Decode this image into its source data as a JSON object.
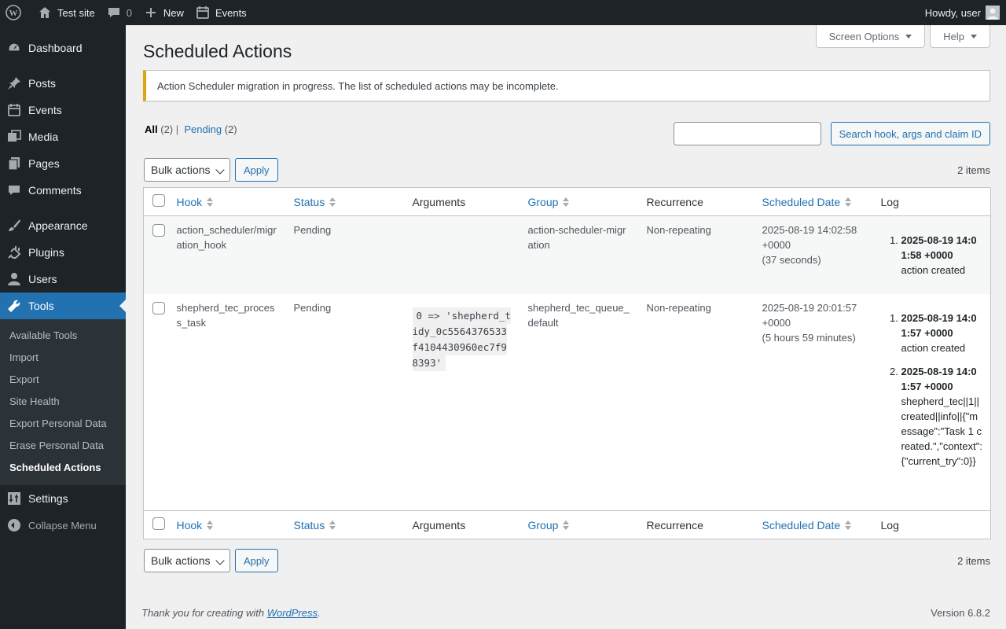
{
  "adminbar": {
    "site_name": "Test site",
    "comments_count": "0",
    "new_label": "New",
    "events_label": "Events",
    "howdy": "Howdy, user"
  },
  "sidebar": {
    "items": [
      {
        "label": "Dashboard",
        "icon": "dashboard-icon"
      },
      {
        "label": "Posts",
        "icon": "pin-icon"
      },
      {
        "label": "Events",
        "icon": "calendar-icon"
      },
      {
        "label": "Media",
        "icon": "media-icon"
      },
      {
        "label": "Pages",
        "icon": "pages-icon"
      },
      {
        "label": "Comments",
        "icon": "comment-icon"
      },
      {
        "label": "Appearance",
        "icon": "brush-icon"
      },
      {
        "label": "Plugins",
        "icon": "plugin-icon"
      },
      {
        "label": "Users",
        "icon": "user-icon"
      },
      {
        "label": "Tools",
        "icon": "wrench-icon"
      },
      {
        "label": "Settings",
        "icon": "settings-icon"
      }
    ],
    "tools_submenu": [
      "Available Tools",
      "Import",
      "Export",
      "Site Health",
      "Export Personal Data",
      "Erase Personal Data",
      "Scheduled Actions"
    ],
    "collapse_label": "Collapse Menu"
  },
  "screen_options_label": "Screen Options",
  "help_label": "Help",
  "page_title": "Scheduled Actions",
  "notice": "Action Scheduler migration in progress. The list of scheduled actions may be incomplete.",
  "views": {
    "all_label": "All",
    "all_count": "(2)",
    "separator": " |",
    "pending_label": "Pending",
    "pending_count": "(2)"
  },
  "search": {
    "button_label": "Search hook, args and claim ID",
    "value": ""
  },
  "bulk": {
    "selected": "Bulk actions",
    "apply_label": "Apply",
    "items_count": "2 items"
  },
  "columns": [
    "Hook",
    "Status",
    "Arguments",
    "Group",
    "Recurrence",
    "Scheduled Date",
    "Log"
  ],
  "rows": [
    {
      "hook": "action_scheduler/migration_hook",
      "status": "Pending",
      "arguments": "",
      "group": "action-scheduler-migration",
      "recurrence": "Non-repeating",
      "date": "2025-08-19 14:02:58 +0000",
      "relative": "(37 seconds)",
      "log": [
        {
          "date": "2025-08-19 14:01:58 +0000",
          "message": "action created"
        }
      ]
    },
    {
      "hook": "shepherd_tec_process_task",
      "status": "Pending",
      "arguments": "0 => 'shepherd_tidy_0c5564376533f4104430960ec7f98393'",
      "group": "shepherd_tec_queue_default",
      "recurrence": "Non-repeating",
      "date": "2025-08-19 20:01:57 +0000",
      "relative": "(5 hours 59 minutes)",
      "log": [
        {
          "date": "2025-08-19 14:01:57 +0000",
          "message": "action created"
        },
        {
          "date": "2025-08-19 14:01:57 +0000",
          "message": "shepherd_tec||1||created||info||{\"message\":\"Task 1 created.\",\"context\":{\"current_try\":0}}"
        }
      ]
    }
  ],
  "footer": {
    "thanks_prefix": "Thank you for creating with ",
    "wp_link": "WordPress",
    "thanks_suffix": ".",
    "version": "Version 6.8.2"
  }
}
